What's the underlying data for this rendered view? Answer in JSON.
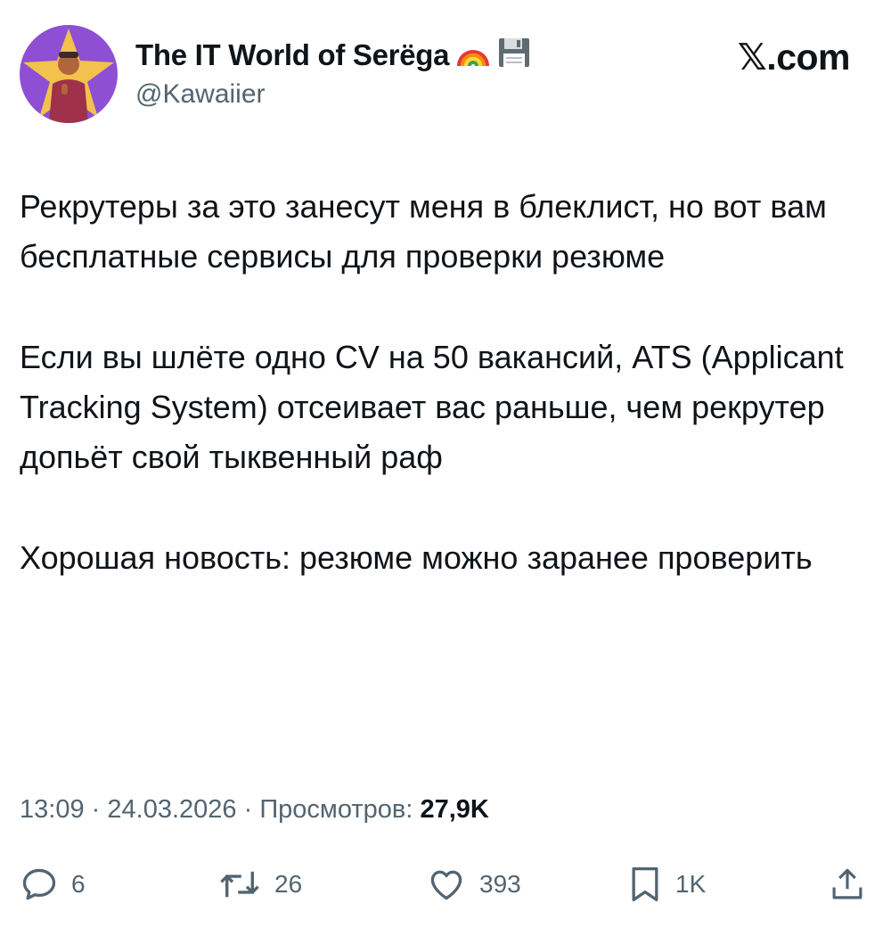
{
  "header": {
    "display_name": "The IT World of Serëga",
    "handle": "@Kawaiier",
    "site_label": "𝕏.com",
    "name_emoji": [
      "rainbow-icon",
      "floppy-disk-icon"
    ]
  },
  "tweet": {
    "paragraphs": [
      "Рекрутеры за это занесут меня в блеклист, но вот вам бесплатные сервисы для проверки резюме",
      "Если вы шлёте одно CV на 50 вакансий, ATS (Applicant Tracking System) отсеивает вас раньше, чем рекрутер допьёт свой тыквенный раф",
      "Хорошая новость: резюме можно заранее проверить"
    ],
    "time": "13:09",
    "separator": "·",
    "date": "24.03.2026",
    "views_label": "Просмотров:",
    "views_count": "27,9K"
  },
  "actions": {
    "replies": "6",
    "reposts": "26",
    "likes": "393",
    "bookmarks": "1K",
    "icons": [
      "reply-icon",
      "repost-icon",
      "like-icon",
      "bookmark-icon",
      "share-icon"
    ]
  },
  "colors": {
    "text_primary": "#0f1419",
    "text_secondary": "#536471",
    "avatar_background": "#8e4fd4",
    "avatar_accent": "#f2c14e"
  }
}
